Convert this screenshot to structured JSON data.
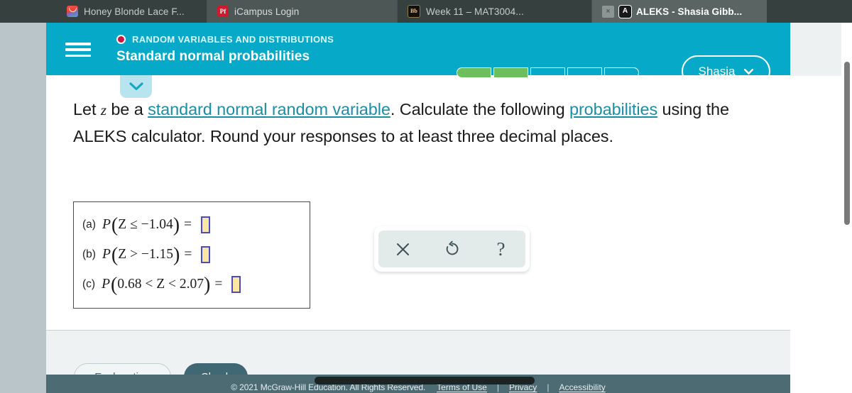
{
  "browser": {
    "tabs": [
      {
        "title": "Honey Blonde Lace F...",
        "icon": "honey-favicon",
        "active": false
      },
      {
        "title": "iCampus Login",
        "icon": "pf-favicon",
        "active": false
      },
      {
        "title": "Week 11 – MAT3004...",
        "icon": "blackboard-favicon",
        "active": false
      },
      {
        "title": "ALEKS - Shasia Gibb...",
        "icon": "aleks-favicon",
        "active": true,
        "close_label": "×"
      }
    ]
  },
  "header": {
    "menu_icon": "hamburger-icon",
    "topic": "RANDOM VARIABLES AND DISTRIBUTIONS",
    "topic_dot_color": "#ca1346",
    "title": "Standard normal probabilities",
    "accent_color": "#06aac8",
    "progress": {
      "total": 5,
      "filled": 2,
      "fill_color": "#6cbf5c"
    },
    "user": {
      "name": "Shasia",
      "caret_icon": "chevron-down-icon"
    }
  },
  "collapse_tab": {
    "icon": "chevron-down-icon"
  },
  "question": {
    "part1": "Let ",
    "variable": "z",
    "part2": " be a ",
    "link1": "standard normal random variable",
    "part3": ". Calculate the following ",
    "link2": "probabilities",
    "part4": " using the ALEKS calculator. Round your responses to at least three decimal places."
  },
  "answers": {
    "rows": [
      {
        "label": "(a)",
        "fn": "P",
        "open": "(",
        "body": "Z ≤ −1.04",
        "close": ")",
        "eq": "=",
        "value": ""
      },
      {
        "label": "(b)",
        "fn": "P",
        "open": "(",
        "body": "Z > −1.15",
        "close": ")",
        "eq": "=",
        "value": ""
      },
      {
        "label": "(c)",
        "fn": "P",
        "open": "(",
        "body": "0.68 < Z < 2.07",
        "close": ")",
        "eq": "=",
        "value": ""
      }
    ],
    "input_fill": "#fbe6a6",
    "input_border": "#4b4cc4"
  },
  "math_toolbar": {
    "buttons": [
      {
        "name": "clear",
        "glyph": "×"
      },
      {
        "name": "undo",
        "glyph": "↺"
      },
      {
        "name": "help",
        "glyph": "?"
      }
    ]
  },
  "actions": {
    "explanation_label": "Explanation",
    "check_label": "Check",
    "check_color": "#3f6874"
  },
  "footer": {
    "copyright": "© 2021 McGraw-Hill Education. All Rights Reserved.",
    "links": [
      "Terms of Use",
      "Privacy",
      "Accessibility"
    ],
    "separator": "|"
  }
}
